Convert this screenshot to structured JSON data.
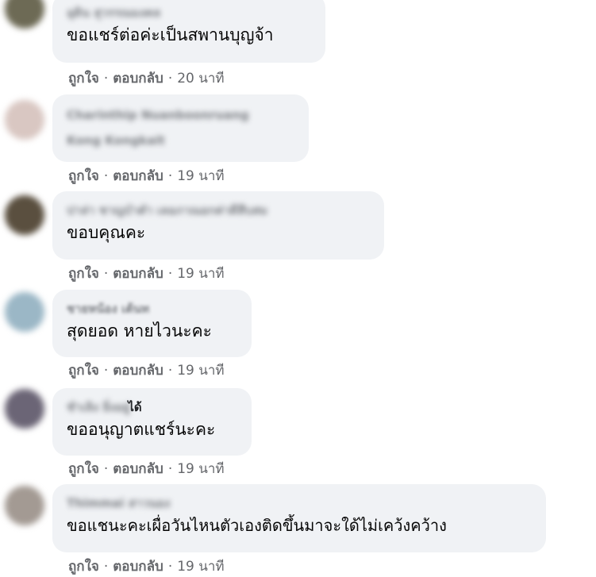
{
  "comments": [
    {
      "name_blurred": "อุดิน สุวรรณมงคล",
      "name_clear": "",
      "text": "ขอแชร์ต่อค่ะเป็นสพานบุญจ้า",
      "like": "ถูกใจ",
      "reply": "ตอบกลับ",
      "sep": "·",
      "time": "20 นาที",
      "avatar_color": "#6d6a55"
    },
    {
      "name_blurred": "Charinthip Nuanboonruang",
      "name_line2_blurred": "Kong Kongkait",
      "name_clear": "",
      "text": "",
      "like": "ถูกใจ",
      "reply": "ตอบกลับ",
      "sep": "·",
      "time": "19 นาที",
      "avatar_color": "#d9c7c2"
    },
    {
      "name_blurred": "ปาล่า ชาญบำตำ เลอภาณอกค่าดีสีบสม",
      "name_clear": "",
      "text": "ขอบคุณคะ",
      "like": "ถูกใจ",
      "reply": "ตอบกลับ",
      "sep": "·",
      "time": "19 นาที",
      "avatar_color": "#5a4f3f"
    },
    {
      "name_blurred": "ชายหน้อง เต้นท",
      "name_clear": "",
      "text": "สุดยอด หายไวนะคะ",
      "like": "ถูกใจ",
      "reply": "ตอบกลับ",
      "sep": "·",
      "time": "19 นาที",
      "avatar_color": "#9bb7c6"
    },
    {
      "name_blurred": "ชำเลิง ยิ่งอยู่",
      "name_clear": "ได้",
      "text": "ขออนุญาตแชร์นะคะ",
      "like": "ถูกใจ",
      "reply": "ตอบกลับ",
      "sep": "·",
      "time": "19 นาที",
      "avatar_color": "#6b6576"
    },
    {
      "name_blurred": "Thimmai สาวนอง",
      "name_clear": "",
      "text": "ขอแชนะคะเผื่อวันไหนตัวเองติดขึ้นมาจะใด้ไม่เคว้งคว้าง",
      "like": "ถูกใจ",
      "reply": "ตอบกลับ",
      "sep": "·",
      "time": "19 นาที",
      "avatar_color": "#a39a93"
    }
  ]
}
